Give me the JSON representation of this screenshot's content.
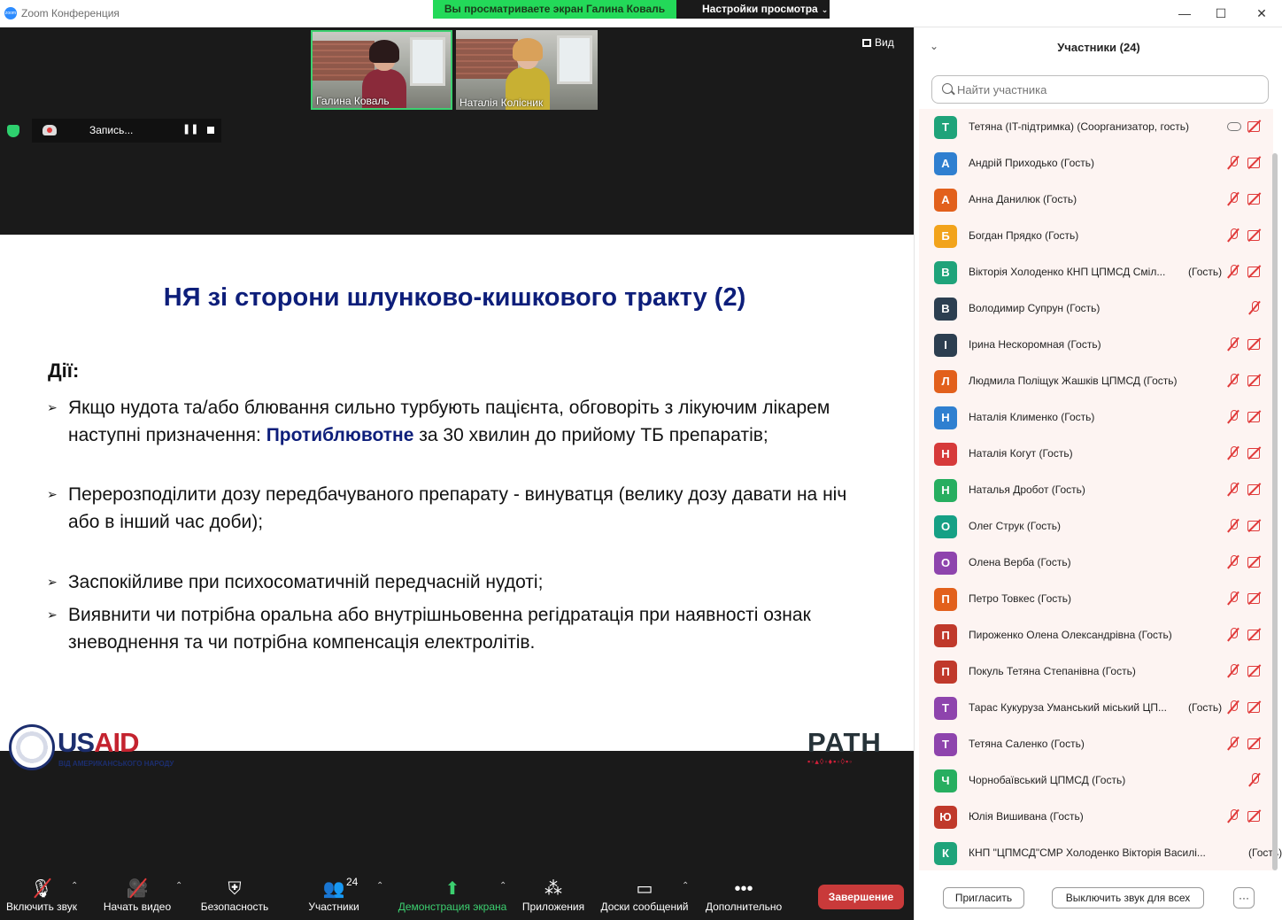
{
  "window": {
    "app_title": "Zoom Конференция",
    "share_banner": "Вы просматриваете экран Галина Коваль",
    "view_options_label": "Настройки просмотра",
    "controls": [
      "—",
      "☐",
      "✕"
    ]
  },
  "meeting": {
    "view_button": "Вид",
    "recording_label": "Запись...",
    "videos": [
      {
        "name": "Галина Коваль",
        "active": true
      },
      {
        "name": "Наталія Колісник",
        "active": false
      }
    ]
  },
  "slide": {
    "title": "НЯ зі сторони шлунково-кишкового тракту (2)",
    "actions_label": "Дії:",
    "bullets": [
      {
        "pre": "Якщо нудота та/або блювання сильно турбують пацієнта, обговоріть з лікуючим лікарем наступні призначення:  ",
        "highlight": "Протиблювотне",
        "post": " за 30 хвилин до прийому ТБ препаратів;"
      },
      {
        "text": "Перерозподілити дозу передбачуваного препарату - винуватця (велику дозу давати на ніч або в інший час доби);"
      },
      {
        "text": "Заспокійливе при психосоматичній передчасній нудоті;"
      },
      {
        "text": "Виявнити чи потрібна оральна або внутрішньовенна регідратація при наявності ознак зневоднення та чи потрібна компенсація електролітів."
      }
    ],
    "logo_usaid_us": "US",
    "logo_usaid_aid": "AID",
    "logo_usaid_sub": "ВІД АМЕРИКАНСЬКОГО НАРОДУ",
    "logo_path": "PATH"
  },
  "toolbar": {
    "audio": "Включить звук",
    "video": "Начать видео",
    "security": "Безопасность",
    "participants": "Участники",
    "participants_count": "24",
    "share": "Демонстрация экрана",
    "apps": "Приложения",
    "whiteboards": "Доски сообщений",
    "more": "Дополнительно",
    "end": "Завершение"
  },
  "panel": {
    "title": "Участники (24)",
    "search_placeholder": "Найти участника",
    "invite_button": "Пригласить",
    "mute_all_button": "Выключить звук для всех",
    "more_button": "···",
    "participants": [
      {
        "initial": "Т",
        "color": "#1fa37a",
        "name": "Тетяна (IT-підтримка) (Соорганизатор, гость)",
        "role": "",
        "mic": "cloud",
        "cam": true
      },
      {
        "initial": "А",
        "color": "#2f7fd0",
        "name": "Андрій Приходько (Гость)",
        "role": "",
        "mic": "off",
        "cam": true
      },
      {
        "initial": "А",
        "color": "#e2601c",
        "name": "Анна Данилюк (Гость)",
        "role": "",
        "mic": "off",
        "cam": true
      },
      {
        "initial": "Б",
        "color": "#f2a31b",
        "name": "Богдан Прядко (Гость)",
        "role": "",
        "mic": "off",
        "cam": true
      },
      {
        "initial": "В",
        "color": "#1fa37a",
        "name": "Вікторія Холоденко КНП ЦПМСД Сміл...",
        "role": "(Гость)",
        "mic": "off",
        "cam": true
      },
      {
        "initial": "В",
        "color": "#2c3e50",
        "name": "Володимир Супрун (Гость)",
        "role": "",
        "mic": "off",
        "cam": false
      },
      {
        "initial": "І",
        "color": "#2c3e50",
        "name": "Ірина Нескоромная (Гость)",
        "role": "",
        "mic": "off",
        "cam": true
      },
      {
        "initial": "Л",
        "color": "#e2601c",
        "name": "Людмила Поліщук Жашків ЦПМСД (Гость)",
        "role": "",
        "mic": "off",
        "cam": true
      },
      {
        "initial": "Н",
        "color": "#2f7fd0",
        "name": "Наталія Клименко (Гость)",
        "role": "",
        "mic": "off",
        "cam": true
      },
      {
        "initial": "Н",
        "color": "#d63a3a",
        "name": "Наталія Когут (Гость)",
        "role": "",
        "mic": "off",
        "cam": true
      },
      {
        "initial": "Н",
        "color": "#27ae60",
        "name": "Наталья Дробот (Гость)",
        "role": "",
        "mic": "off",
        "cam": true
      },
      {
        "initial": "О",
        "color": "#16a085",
        "name": "Олег Струк (Гость)",
        "role": "",
        "mic": "off",
        "cam": true
      },
      {
        "initial": "О",
        "color": "#8e44ad",
        "name": "Олена Верба (Гость)",
        "role": "",
        "mic": "off",
        "cam": true
      },
      {
        "initial": "П",
        "color": "#e2601c",
        "name": "Петро Товкес (Гость)",
        "role": "",
        "mic": "off",
        "cam": true
      },
      {
        "initial": "П",
        "color": "#c0392b",
        "name": "Пироженко Олена Олександрівна (Гость)",
        "role": "",
        "mic": "off",
        "cam": true
      },
      {
        "initial": "П",
        "color": "#c0392b",
        "name": "Покуль Тетяна Степанівна (Гость)",
        "role": "",
        "mic": "off",
        "cam": true
      },
      {
        "initial": "Т",
        "color": "#8e44ad",
        "name": "Тарас Кукуруза Уманський міський ЦП...",
        "role": "(Гость)",
        "mic": "off",
        "cam": true
      },
      {
        "initial": "Т",
        "color": "#8e44ad",
        "name": "Тетяна Саленко (Гость)",
        "role": "",
        "mic": "off",
        "cam": true
      },
      {
        "initial": "Ч",
        "color": "#27ae60",
        "name": "Чорнобаївський ЦПМСД (Гость)",
        "role": "",
        "mic": "off",
        "cam": false
      },
      {
        "initial": "Ю",
        "color": "#c0392b",
        "name": "Юлія Вишивана (Гость)",
        "role": "",
        "mic": "off",
        "cam": true
      },
      {
        "initial": "К",
        "color": "#1fa37a",
        "name": "КНП \"ЦПМСД\"СМР Холоденко Вікторія Василі...",
        "role": "(Гость)",
        "mic": "none",
        "cam": false
      }
    ]
  }
}
